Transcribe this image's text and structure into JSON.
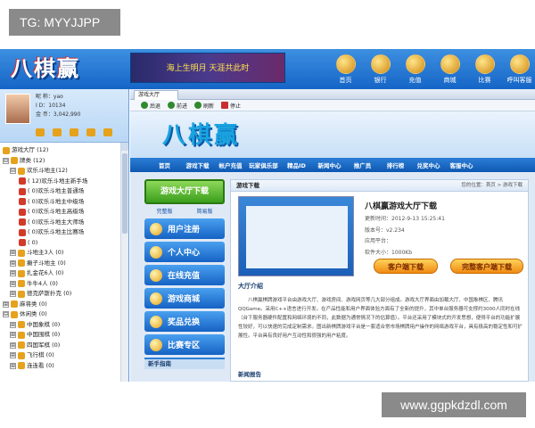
{
  "watermark": {
    "top_left": "TG: MYYJJPP",
    "bottom_right": "www.ggpkdzdl.com"
  },
  "app": {
    "logo": "八棋赢",
    "banner_text": "海上生明月  天涯共此时",
    "top_nav": [
      "首页",
      "银行",
      "充值",
      "商城",
      "比赛",
      "呼叫客服"
    ]
  },
  "profile": {
    "line1": "昵  称：yao",
    "line2": "I   D：10134",
    "line3": "金  币：3,042,990"
  },
  "tree": [
    {
      "level": 0,
      "text": "游戏大厅 (12)"
    },
    {
      "level": 0,
      "box": "⊟",
      "text": "牌类 (12)"
    },
    {
      "level": 1,
      "box": "⊟",
      "text": "欢乐斗地主(12)"
    },
    {
      "level": 2,
      "text": "( 12)欢乐斗地主新手场"
    },
    {
      "level": 2,
      "text": "( 0)欢乐斗地主普通场"
    },
    {
      "level": 2,
      "text": "( 0)欢乐斗地主中级场"
    },
    {
      "level": 2,
      "text": "( 0)欢乐斗地主高级场"
    },
    {
      "level": 2,
      "text": "( 0)欢乐斗地主大师场"
    },
    {
      "level": 2,
      "text": "( 0)欢乐斗地主比赛场"
    },
    {
      "level": 2,
      "text": "( 0)"
    },
    {
      "level": 1,
      "box": "⊞",
      "text": "斗地主3人 (0)"
    },
    {
      "level": 1,
      "box": "⊞",
      "text": "癞子斗地主 (0)"
    },
    {
      "level": 1,
      "box": "⊞",
      "text": "扎金花6人 (0)"
    },
    {
      "level": 1,
      "box": "⊞",
      "text": "牛牛4人 (0)"
    },
    {
      "level": 1,
      "box": "⊞",
      "text": "德克萨斯扑克 (0)"
    },
    {
      "level": 0,
      "box": "⊞",
      "text": "麻将类 (0)"
    },
    {
      "level": 0,
      "box": "⊟",
      "text": "休闲类 (0)"
    },
    {
      "level": 1,
      "box": "⊞",
      "text": "中国象棋 (0)"
    },
    {
      "level": 1,
      "box": "⊞",
      "text": "中国围棋 (0)"
    },
    {
      "level": 1,
      "box": "⊞",
      "text": "四国军棋 (0)"
    },
    {
      "level": 1,
      "box": "⊞",
      "text": "飞行棋 (0)"
    },
    {
      "level": 1,
      "box": "⊞",
      "text": "连连看 (0)"
    }
  ],
  "browser": {
    "tab_label": "游戏大厅",
    "toolbar": [
      "后退",
      "前进",
      "刷新",
      "停止"
    ]
  },
  "site": {
    "logo": "八棋赢",
    "nav": [
      "首页",
      "游戏下载",
      "帐户充值",
      "玩家俱乐部",
      "精品ID",
      "新闻中心",
      "推广员",
      "排行榜",
      "兑奖中心",
      "客服中心"
    ],
    "download_button": "游戏大厅下载",
    "download_sub": [
      "完整版",
      "简易版"
    ],
    "menu": [
      "用户注册",
      "个人中心",
      "在线充值",
      "游戏商城",
      "奖品兑换",
      "比赛专区"
    ],
    "guide": "新手指南",
    "section_title": "游戏下载",
    "breadcrumb": "您的位置：首页 > 游戏下载",
    "game_title": "八棋赢游戏大厅下载",
    "game_meta": [
      "更新时间：2012-9-13 15:25:41",
      "版本号：v2.234",
      "应用平台：",
      "软件大小：1000Kb"
    ],
    "btn_client": "客户端下载",
    "btn_full": "完整客户端下载",
    "intro_title": "大厅介绍",
    "intro_text": "八棋赢棋牌游戏平台由游戏大厅、游戏房间、游戏网页等几大部分组成。游戏大厅界面由加载大厅、中国象棋区、腾讯QQGame。采用C++语言进行开发。在产品性能和用户界面体验方面有了全新的提升，其中单台服务器可支撑约3000人同时在线（台下服务器硬件配置和网络环境的不同，此数据为通常情况下的估算值）。平台还采用了模块式的开发思想，便得平台的功能扩展性较好，可以快速的完成定制需求。图出新棋牌游戏平台是一套适合常市场棋牌用户操作的网络游戏平台，具有极高的稳定性和可扩展性。平台具有良好用户互动性和很强的用户粘度。",
    "news_title": "新闻报告"
  },
  "colors": {
    "accent": "#1565c7",
    "download_green": "#3a9e1c",
    "orange": "#f08a12"
  }
}
